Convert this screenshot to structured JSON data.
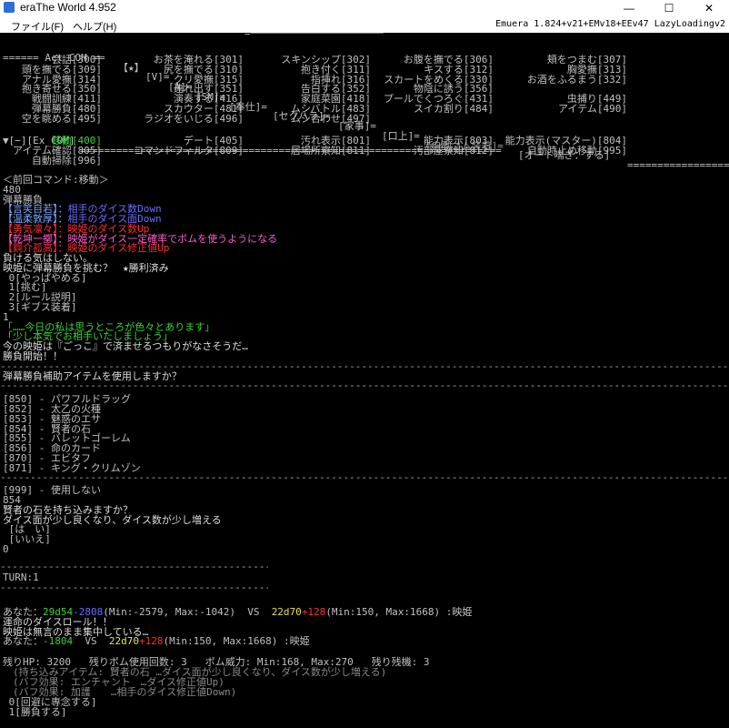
{
  "window": {
    "title": "eraThe World 4.952"
  },
  "menu": {
    "file": "ファイル(F)",
    "help": "ヘルプ(H)",
    "version": "Emuera 1.824+v21+EMv18+EEv47 LazyLoadingv2"
  },
  "act_header": {
    "lead": "====== Act_COM == ",
    "items": [
      "【★】",
      "[V]=",
      "[A]=",
      "[SM]=",
      "[奉仕]=",
      "[セクハラ]=",
      "[家事]=",
      "[口上]=",
      "[自動ゴム装着]=",
      "[オート喘ぎ：する]"
    ],
    "trail": "========================"
  },
  "act_rows": [
    [
      "会話[300]",
      "お茶を淹れる[301]",
      "スキンシップ[302]",
      "お腹を撫でる[306]",
      "頬をつまむ[307]"
    ],
    [
      "頭を撫でる[309]",
      "尻を撫でる[310]",
      "抱き付く[311]",
      "キスする[312]",
      "胸愛撫[313]"
    ],
    [
      "アナル愛撫[314]",
      "クリ愛撫[315]",
      "指挿れ[316]",
      "スカートをめくる[330]",
      "お酒をふるまう[332]"
    ],
    [
      "抱き寄せる[350]",
      "連れ出す[351]",
      "告白する[352]",
      "物陰に誘う[356]",
      ""
    ],
    [
      "戦闘訓練[411]",
      "演奏する[416]",
      "家庭菜園[418]",
      "プールでくつろぐ[431]",
      "虫捕り[449]"
    ],
    [
      "弾幕勝負[480]",
      "スカウター[481]",
      "ムシバトル[483]",
      "スイカ割り[484]",
      "アイテム[490]"
    ],
    [
      "空を眺める[495]",
      "ラジオをいじる[496]",
      "ムシ合わせ[497]",
      "",
      ""
    ]
  ],
  "ex_header": {
    "lead": "▼[−][Ex_COM] ",
    "trail": "======================================================================"
  },
  "ex_rows": [
    [
      "移動[400]",
      "デート[405]",
      "汚れ表示[801]",
      "能力表示[803]",
      "能力表示(マスター)[804]"
    ],
    [
      "アイテム確認[805]",
      "コマンドフィルタ[809]",
      "居場所察知[811]",
      "汚部屋察知[812]",
      "自動時止め移動[995]"
    ],
    [
      "自動掃除[996]",
      "",
      "",
      "",
      ""
    ]
  ],
  "log": {
    "prev_command": "＜前回コマンド:移動＞",
    "num_480": "480",
    "danmaku": "弾幕勝負",
    "effects": [
      [
        "【言笑自若】：",
        "相手のダイス数Down"
      ],
      [
        "【温柔敦厚】：",
        "相手のダイス面Down"
      ],
      [
        "【勇気凛々】：",
        "映姫のダイス数Up"
      ],
      [
        "【乾坤一擲】：",
        "映姫がダイス一定確率でボムを使うようになる"
      ],
      [
        "【鋼介孤高】：",
        "映姫のダイス修正値Up"
      ]
    ],
    "lose_line": "負ける気はしない。",
    "challenge": "映姫に弾幕勝負を挑む？　★勝利済み",
    "choices": [
      " 0[やっぱやめる]",
      " 1[挑む]",
      " 2[ルール説明]",
      " 3[ギブス装着]"
    ],
    "input1": "1",
    "quote1": "「……今日の私は思うところが色々とあります」",
    "quote2": "「少し本気でお相手いたしましょう」",
    "narr1": "今の映姫は『ごっこ』で済ませるつもりがなさそうだ…",
    "start": "勝負開始！！",
    "use_item_q": "弾幕勝負補助アイテムを使用しますか？",
    "items": [
      "[850] - パワフルドラッグ",
      "[852] - 太乙の火種",
      "[853] - 魅惑のエサ",
      "[854] - 賢者の石",
      "[855] - バレットゴーレム",
      "[856] - 命のカード",
      "[870] - エビタフ",
      "[871] - キング・クリムゾン"
    ],
    "no_use": "[999] - 使用しない",
    "input854": "854",
    "bring_q": "賢者の石を持ち込みますか？",
    "bring_desc": "ダイス面が少し良くなり、ダイス数が少し増える",
    "yes": " [は　い]",
    "no": " [いいえ]",
    "input0": "0",
    "turn": "TURN:1",
    "dice1": {
      "lead": "あなた：",
      "you_dice": "29d54",
      "you_mod": "-2808",
      "you_range": "(Min:-2579, Max:-1042)  VS  ",
      "opp_dice": "22d70",
      "opp_mod": "+128",
      "opp_range": "(Min:150, Max:1668) :映姫"
    },
    "fate": "運命のダイスロール！！",
    "focus": "映姫は無言のまま集中している…",
    "dice2": {
      "lead": "あなた：",
      "you_val": "-1804",
      "vs": "  VS  ",
      "opp_dice": "22d70",
      "opp_mod": "+128",
      "opp_range": "(Min:150, Max:1668) :映姫"
    },
    "status": "残りHP: 3200   残りボム使用回数: 3   ボム威力: Min:168, Max:270   残り残機: 3",
    "carry": "　(持ち込みアイテム: 賢者の石 …ダイス面が少し良くなり、ダイス数が少し増える)",
    "buff1": "　(バフ効果: エンチャント　…ダイス修正値Up)",
    "buff2": "　(バフ効果: 加護　　…相手のダイス修正値Down)",
    "final_choices": [
      " 0[回避に専念する]",
      " 1[勝負する]"
    ]
  },
  "colors": {
    "bg": "#000000",
    "text": "#c0c0c0",
    "green": "#3cd33c",
    "red": "#ff3030",
    "blue": "#6b6bff",
    "pink": "#ff5ccd",
    "cyan": "#4fd6d6",
    "yellow": "#e8e050"
  },
  "icons": {
    "app": "app-icon",
    "minimize": "minimize-icon",
    "maximize": "maximize-icon",
    "close": "close-icon"
  }
}
